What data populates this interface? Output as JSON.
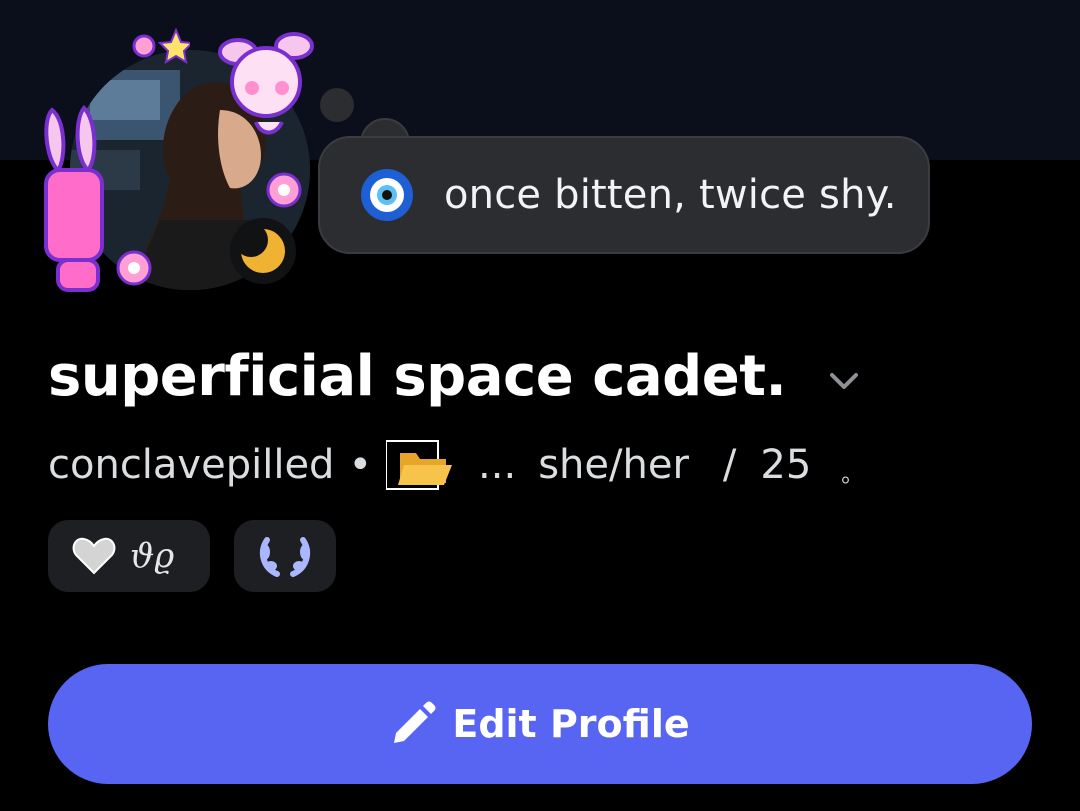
{
  "profile": {
    "display_name": "superficial space cadet.",
    "username": "conclavepilled",
    "separator": "•",
    "ellipsis": "...",
    "pronouns": "she/her",
    "slash": "/",
    "age": "25",
    "trailing": "。"
  },
  "status": {
    "emoji_icon": "nazar-amulet-icon",
    "text": "once bitten, twice shy."
  },
  "tags": [
    {
      "icon": "heart-icon",
      "text": "ϑϱ"
    },
    {
      "icon": "laurel-wreath-icon",
      "text": ""
    }
  ],
  "actions": {
    "edit_label": "Edit Profile"
  },
  "colors": {
    "background": "#000000",
    "banner": "#0b0f1c",
    "bubble": "#2b2d31",
    "button": "#5865f2",
    "moon": "#f0b232"
  }
}
